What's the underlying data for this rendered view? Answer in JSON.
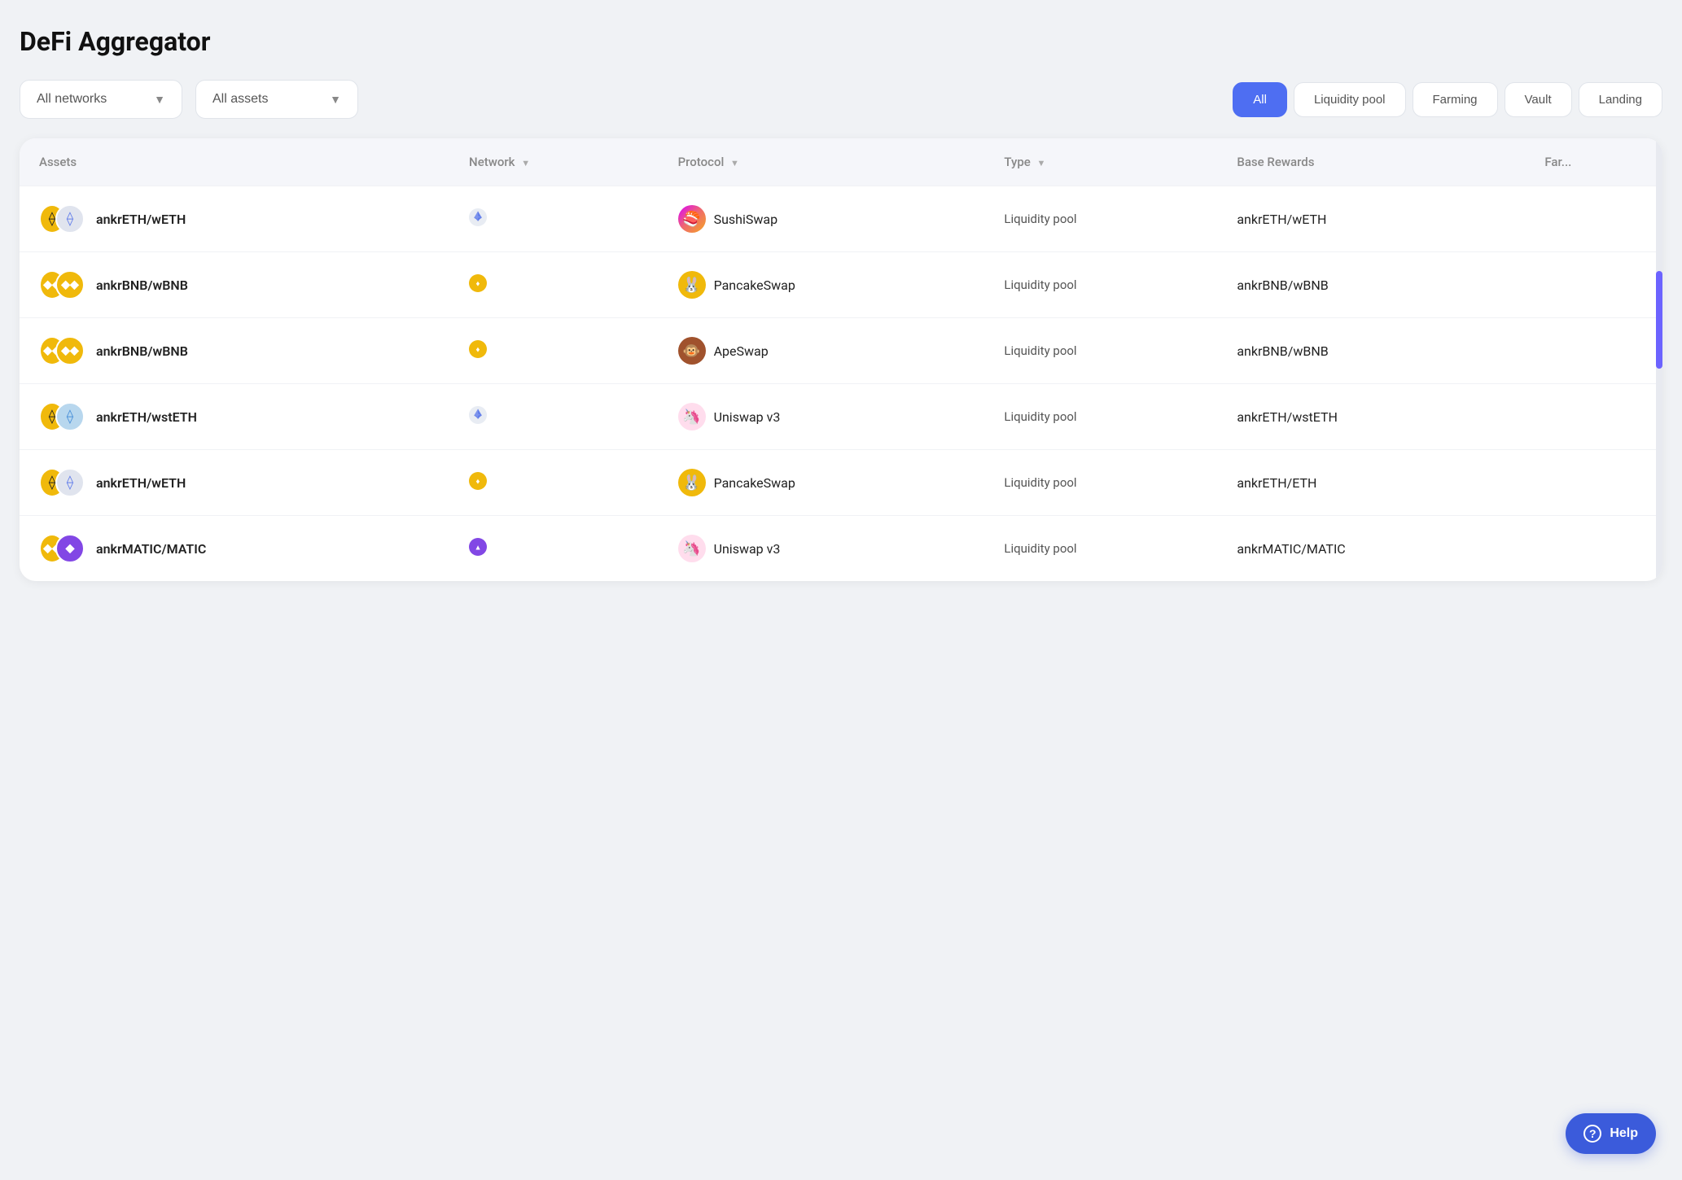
{
  "page": {
    "title": "DeFi Aggregator"
  },
  "filters": {
    "network_label": "All networks",
    "asset_label": "All assets"
  },
  "tabs": [
    {
      "id": "all",
      "label": "All",
      "active": true
    },
    {
      "id": "liquidity_pool",
      "label": "Liquidity pool",
      "active": false
    },
    {
      "id": "farming",
      "label": "Farming",
      "active": false
    },
    {
      "id": "vault",
      "label": "Vault",
      "active": false
    },
    {
      "id": "landing",
      "label": "Landing",
      "active": false
    }
  ],
  "table": {
    "columns": [
      {
        "id": "assets",
        "label": "Assets",
        "sortable": false
      },
      {
        "id": "network",
        "label": "Network",
        "sortable": true
      },
      {
        "id": "protocol",
        "label": "Protocol",
        "sortable": true
      },
      {
        "id": "type",
        "label": "Type",
        "sortable": true
      },
      {
        "id": "base_rewards",
        "label": "Base Rewards",
        "sortable": false
      },
      {
        "id": "farming",
        "label": "Far...",
        "sortable": false
      }
    ],
    "rows": [
      {
        "id": 1,
        "asset_name": "ankrETH/wETH",
        "asset_icon1": "ankr-eth",
        "asset_icon2": "weth",
        "network_icon": "ethereum",
        "protocol_icon": "sushiswap",
        "protocol_name": "SushiSwap",
        "type": "Liquidity pool",
        "base_rewards": "ankrETH/wETH"
      },
      {
        "id": 2,
        "asset_name": "ankrBNB/wBNB",
        "asset_icon1": "ankr-bnb",
        "asset_icon2": "wbnb",
        "network_icon": "bnb",
        "protocol_icon": "pancakeswap",
        "protocol_name": "PancakeSwap",
        "type": "Liquidity pool",
        "base_rewards": "ankrBNB/wBNB"
      },
      {
        "id": 3,
        "asset_name": "ankrBNB/wBNB",
        "asset_icon1": "ankr-bnb",
        "asset_icon2": "wbnb",
        "network_icon": "bnb",
        "protocol_icon": "apeswap",
        "protocol_name": "ApeSwap",
        "type": "Liquidity pool",
        "base_rewards": "ankrBNB/wBNB"
      },
      {
        "id": 4,
        "asset_name": "ankrETH/wstETH",
        "asset_icon1": "ankr-eth",
        "asset_icon2": "wsteth",
        "network_icon": "ethereum",
        "protocol_icon": "uniswap",
        "protocol_name": "Uniswap v3",
        "type": "Liquidity pool",
        "base_rewards": "ankrETH/wstETH"
      },
      {
        "id": 5,
        "asset_name": "ankrETH/wETH",
        "asset_icon1": "ankr-eth",
        "asset_icon2": "weth",
        "network_icon": "bnb",
        "protocol_icon": "pancakeswap",
        "protocol_name": "PancakeSwap",
        "type": "Liquidity pool",
        "base_rewards": "ankrETH/ETH"
      },
      {
        "id": 6,
        "asset_name": "ankrMATIC/MATIC",
        "asset_icon1": "ankr-matic",
        "asset_icon2": "matic",
        "network_icon": "polygon",
        "protocol_icon": "uniswap",
        "protocol_name": "Uniswap v3",
        "type": "Liquidity pool",
        "base_rewards": "ankrMATIC/MATIC"
      }
    ]
  },
  "help": {
    "label": "Help"
  }
}
